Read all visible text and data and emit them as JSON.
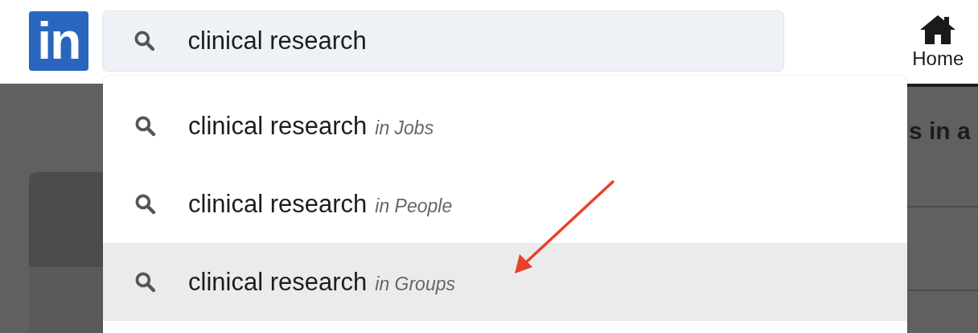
{
  "header": {
    "logo": "in",
    "search": {
      "value": "clinical research"
    },
    "nav": [
      {
        "label": "Home"
      }
    ]
  },
  "suggestions": [
    {
      "query": "clinical research",
      "scope": "in Jobs",
      "selected": false
    },
    {
      "query": "clinical research",
      "scope": "in People",
      "selected": false
    },
    {
      "query": "clinical research",
      "scope": "in Groups",
      "selected": true
    }
  ],
  "background": {
    "heading": "s in a"
  }
}
